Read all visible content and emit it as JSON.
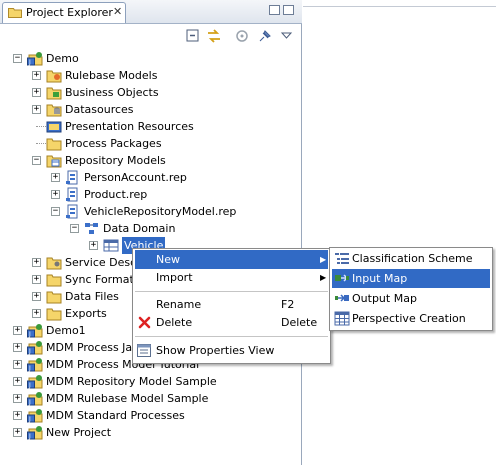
{
  "view": {
    "tab_title": "Project Explorer",
    "close_glyph": "✕"
  },
  "tree": {
    "rows": [
      {
        "label": "Demo",
        "icon": "project-icon",
        "indent": 0,
        "toggle": "−"
      },
      {
        "label": "Rulebase Models",
        "icon": "folder-rules-icon",
        "indent": 1,
        "toggle": "+"
      },
      {
        "label": "Business Objects",
        "icon": "folder-bo-icon",
        "indent": 1,
        "toggle": "+"
      },
      {
        "label": "Datasources",
        "icon": "folder-db-icon",
        "indent": 1,
        "toggle": "+"
      },
      {
        "label": "Presentation Resources",
        "icon": "folder-presentation-icon",
        "indent": 1,
        "toggle": ""
      },
      {
        "label": "Process Packages",
        "icon": "folder-process-icon",
        "indent": 1,
        "toggle": ""
      },
      {
        "label": "Repository Models",
        "icon": "folder-repository-icon",
        "indent": 1,
        "toggle": "−"
      },
      {
        "label": "PersonAccount.rep",
        "icon": "rep-file-icon",
        "indent": 2,
        "toggle": "+"
      },
      {
        "label": "Product.rep",
        "icon": "rep-file-icon",
        "indent": 2,
        "toggle": "+"
      },
      {
        "label": "VehicleRepositoryModel.rep",
        "icon": "rep-file-icon",
        "indent": 2,
        "toggle": "−"
      },
      {
        "label": "Data Domain",
        "icon": "data-domain-icon",
        "indent": 3,
        "toggle": "−"
      },
      {
        "label": "Vehicle",
        "icon": "table-icon",
        "indent": 4,
        "toggle": "+",
        "selected": true
      },
      {
        "label": "Service Desc",
        "icon": "folder-service-icon",
        "indent": 1,
        "toggle": "+"
      },
      {
        "label": "Sync Formats",
        "icon": "folder-sync-icon",
        "indent": 1,
        "toggle": "+"
      },
      {
        "label": "Data Files",
        "icon": "folder-icon",
        "indent": 1,
        "toggle": "+"
      },
      {
        "label": "Exports",
        "icon": "folder-icon",
        "indent": 1,
        "toggle": "+"
      },
      {
        "label": "Demo1",
        "icon": "project-icon",
        "indent": 0,
        "toggle": "+"
      },
      {
        "label": "MDM Process Jav",
        "icon": "project-icon",
        "indent": 0,
        "toggle": "+"
      },
      {
        "label": "MDM Process Model Tutorial",
        "icon": "project-icon",
        "indent": 0,
        "toggle": "+"
      },
      {
        "label": "MDM Repository Model Sample",
        "icon": "project-icon",
        "indent": 0,
        "toggle": "+"
      },
      {
        "label": "MDM Rulebase Model Sample",
        "icon": "project-icon",
        "indent": 0,
        "toggle": "+"
      },
      {
        "label": "MDM Standard Processes",
        "icon": "project-icon",
        "indent": 0,
        "toggle": "+"
      },
      {
        "label": "New Project",
        "icon": "project-icon",
        "indent": 0,
        "toggle": "+"
      }
    ]
  },
  "context_menu": {
    "items": [
      {
        "label": "New",
        "shortcut": "",
        "arrow": "▶",
        "selected": true
      },
      {
        "label": "Import",
        "shortcut": "",
        "arrow": "▶"
      },
      {
        "label": "Rename",
        "shortcut": "F2",
        "arrow": ""
      },
      {
        "label": "Delete",
        "shortcut": "Delete",
        "arrow": "",
        "icon": "delete-icon"
      },
      {
        "label": "Show Properties View",
        "shortcut": "",
        "arrow": "",
        "icon": "properties-icon"
      }
    ]
  },
  "submenu": {
    "items": [
      {
        "label": "Classification Scheme",
        "icon": "classification-icon"
      },
      {
        "label": "Input Map",
        "icon": "input-map-icon",
        "selected": true
      },
      {
        "label": "Output Map",
        "icon": "output-map-icon"
      },
      {
        "label": "Perspective Creation",
        "icon": "perspective-icon"
      }
    ]
  },
  "colors": {
    "selection": "#316ac5",
    "border": "#8a8a8a"
  }
}
